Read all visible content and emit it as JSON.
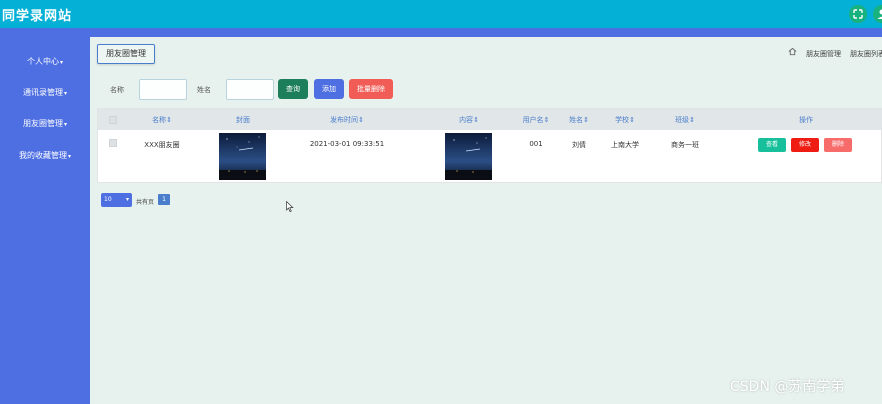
{
  "app": {
    "title": "同学录网站"
  },
  "header_icons": [
    {
      "name": "fullscreen-icon",
      "glyph": "⤧"
    },
    {
      "name": "user-icon",
      "glyph": "☰"
    }
  ],
  "sidebar": {
    "items": [
      {
        "label": "个人中心"
      },
      {
        "label": "通讯录管理"
      },
      {
        "label": "朋友圈管理"
      },
      {
        "label": "我的收藏管理"
      }
    ]
  },
  "tab": {
    "label": "朋友圈管理"
  },
  "breadcrumb": {
    "items": [
      "朋友圈管理",
      "朋友圈列表"
    ]
  },
  "search": {
    "name_label": "名称",
    "name_value": "",
    "realname_label": "姓名",
    "realname_value": "",
    "query_label": "查询",
    "add_label": "添加",
    "batch_delete_label": "批量删除"
  },
  "table": {
    "headers": [
      "名称",
      "封面",
      "发布时间",
      "内容",
      "用户名",
      "姓名",
      "学校",
      "班级",
      "操作"
    ],
    "rows": [
      {
        "name": "XXX朋友圈",
        "publish_time": "2021-03-01 09:33:51",
        "username": "001",
        "realname": "刘倩",
        "school": "上南大学",
        "class_name": "商务一班",
        "actions": {
          "view": "查看",
          "edit": "修改",
          "delete": "删除"
        }
      }
    ]
  },
  "pagination": {
    "page_size": "10",
    "total_text": "共有页",
    "current_page": "1"
  },
  "watermark": "CSDN @苏南学弟",
  "colors": {
    "topbar": "#05b0d6",
    "sidebar": "#4e6fe2",
    "query_btn": "#1d7e5b",
    "add_btn": "#4e6fe2",
    "batch_delete_btn": "#f15c57",
    "view_btn": "#17c09a",
    "edit_btn": "#ef1c14",
    "delete_btn": "#f76b6b"
  }
}
